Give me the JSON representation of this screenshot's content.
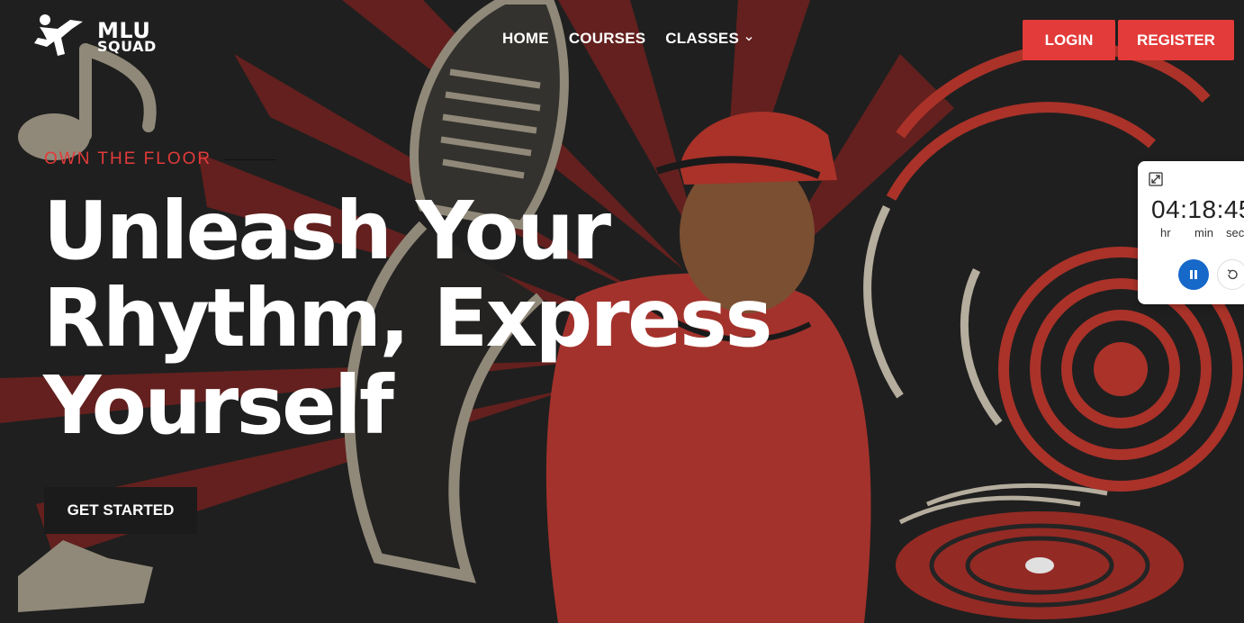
{
  "brand": {
    "line1": "MLU",
    "line2": "SQUAD"
  },
  "nav": {
    "items": [
      {
        "label": "HOME"
      },
      {
        "label": "COURSES"
      },
      {
        "label": "CLASSES"
      }
    ]
  },
  "auth": {
    "login_label": "LOGIN",
    "register_label": "REGISTER"
  },
  "hero": {
    "eyebrow": "OWN THE FLOOR",
    "headline_lines": [
      "Unleash Your",
      "Rhythm, Express",
      "Yourself"
    ],
    "cta_label": "GET STARTED"
  },
  "timer": {
    "time": "04:18:45",
    "units": {
      "hr": "hr",
      "min": "min",
      "sec": "sec"
    }
  },
  "colors": {
    "accent": "#e23b3a",
    "background": "#232323",
    "timer_button": "#1668c9"
  },
  "icons": [
    "breakdancer-logo-icon",
    "chevron-down-icon",
    "expand-icon",
    "pause-icon",
    "reset-icon"
  ]
}
